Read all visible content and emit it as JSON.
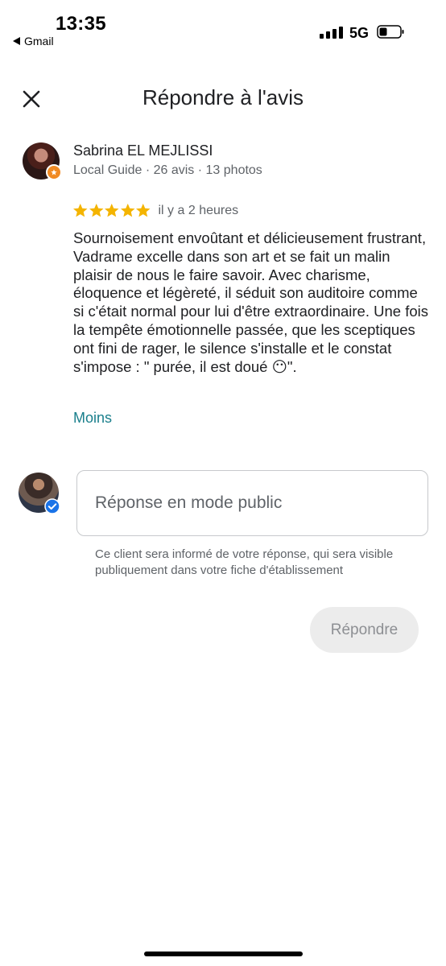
{
  "status_bar": {
    "time": "13:35",
    "back_app": "Gmail",
    "network": "5G"
  },
  "header": {
    "title": "Répondre à l'avis",
    "close_icon": "close-icon"
  },
  "review": {
    "reviewer_name": "Sabrina EL MEJLISSI",
    "reviewer_meta": "Local Guide · 26 avis · 13 photos",
    "rating": 5,
    "max_rating": 5,
    "time_ago": "il y a 2 heures",
    "text": "Sournoisement envoûtant et délicieusement frustrant, Vadrame excelle dans son art et se fait un malin plaisir de nous le faire savoir. Avec charisme, éloquence et légèreté, il séduit son auditoire comme si c'était normal pour lui d'être extraordinaire. Une fois la tempête émotionnelle passée, que les sceptiques ont fini de rager, le silence s'installe et le constat s'impose : \" purée, il est doué 😶\".",
    "less_label": "Moins"
  },
  "reply": {
    "placeholder": "Réponse en mode public",
    "value": "",
    "helper_text": "Ce client sera informé de votre réponse, qui sera visible publiquement dans votre fiche d'établissement",
    "submit_label": "Répondre"
  },
  "colors": {
    "star": "#f4b400",
    "link": "#1a7f8c",
    "guide_badge": "#f08a24",
    "verified": "#1a73e8",
    "disabled_button_bg": "#ececec"
  }
}
